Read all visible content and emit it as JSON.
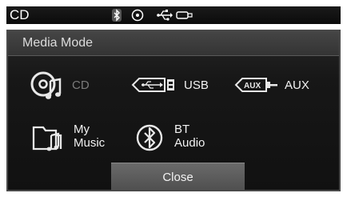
{
  "status_bar": {
    "title": "CD",
    "icons": [
      "bluetooth-icon",
      "disc-icon",
      "usb-icon",
      "aux-icon"
    ]
  },
  "panel": {
    "title": "Media Mode",
    "items": [
      {
        "label": "CD",
        "icon": "cd-icon",
        "enabled": false
      },
      {
        "label": "USB",
        "icon": "usb-icon",
        "enabled": true
      },
      {
        "label": "AUX",
        "icon": "aux-icon",
        "enabled": true
      },
      {
        "label_line1": "My",
        "label_line2": "Music",
        "icon": "my-music-icon",
        "enabled": true
      },
      {
        "label_line1": "BT",
        "label_line2": "Audio",
        "icon": "bluetooth-icon",
        "enabled": true
      }
    ],
    "close_label": "Close",
    "aux_icon_text": "AUX"
  },
  "colors": {
    "background": "#111111",
    "header": "#3c3c3c",
    "text": "#f2f2f2",
    "disabled_text": "#7b7b7b",
    "button": "#5c5c5c"
  }
}
